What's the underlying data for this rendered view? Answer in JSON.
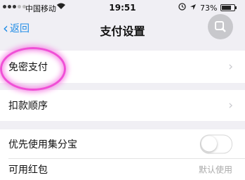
{
  "status_bar": {
    "carrier": "中国移动",
    "time": "19:51",
    "battery_percent": "73%",
    "battery_level": 0.73,
    "icons": [
      "signal-dots-icon",
      "wifi-icon",
      "lock-icon",
      "location-icon",
      "battery-icon"
    ]
  },
  "nav": {
    "back_label": "返回",
    "title": "支付设置"
  },
  "rows": {
    "password_free": {
      "label": "免密支付"
    },
    "deduction_order": {
      "label": "扣款顺序"
    },
    "jifenbao": {
      "label": "优先使用集分宝",
      "toggle_on": false
    },
    "red_packet": {
      "label": "可用红包",
      "value": "默认使用"
    }
  },
  "colors": {
    "accent": "#1f8ce6",
    "background": "#f0eff4",
    "highlight": "#f04fd6"
  }
}
